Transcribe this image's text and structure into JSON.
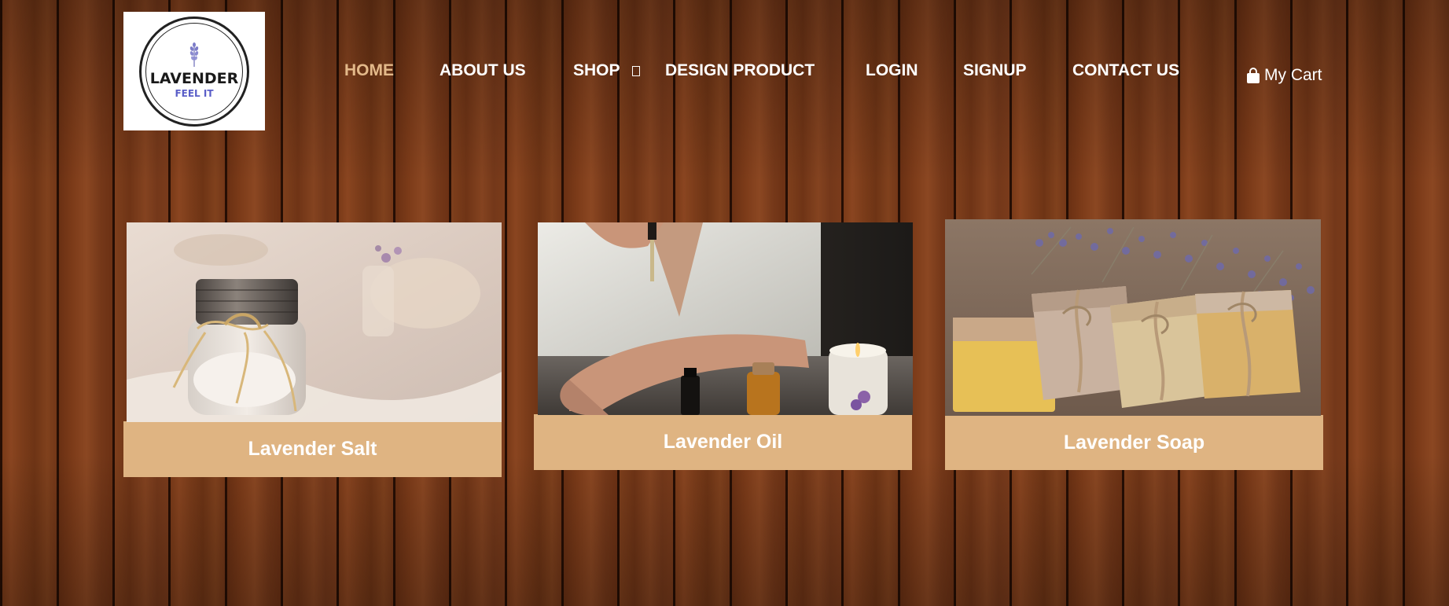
{
  "brand": {
    "logo_main": "LAVENDER",
    "logo_sub": "FEEL IT"
  },
  "nav": {
    "items": [
      {
        "label": "HOME",
        "active": true
      },
      {
        "label": "ABOUT US"
      },
      {
        "label": "SHOP",
        "has_dropdown": true
      },
      {
        "label": "DESIGN PRODUCT"
      },
      {
        "label": "LOGIN"
      },
      {
        "label": "SIGNUP"
      },
      {
        "label": "CONTACT US"
      }
    ],
    "cart_label": "My Cart",
    "cart_icon": "shopping-bag-icon"
  },
  "products": [
    {
      "name": "Lavender Salt",
      "image": "jar of lavender bath salt with raffia bow"
    },
    {
      "name": "Lavender Oil",
      "image": "dropper applying oil to wrist with bottles and candle"
    },
    {
      "name": "Lavender Soap",
      "image": "handmade soap bars tied with twine beside lavender sprigs"
    }
  ],
  "colors": {
    "accent": "#dfb482",
    "active_nav": "#e3b98a",
    "logo_sub": "#5a5ec8",
    "background_wood": "#6b3216"
  }
}
